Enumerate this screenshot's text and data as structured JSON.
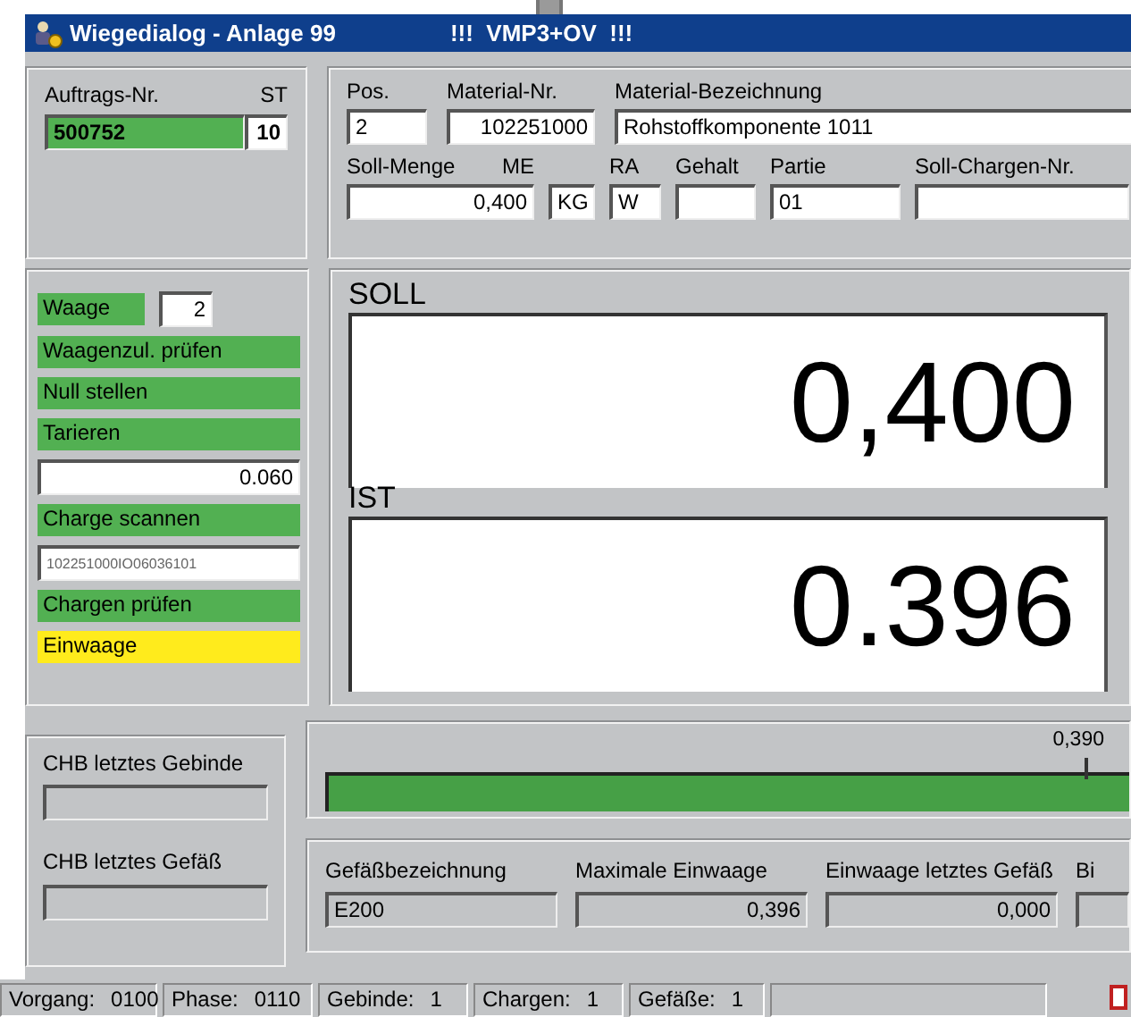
{
  "window": {
    "title": "Wiegedialog - Anlage 99",
    "banner": "!!!  VMP3+OV  !!!"
  },
  "order": {
    "label": "Auftrags-Nr.",
    "value": "500752",
    "st_label": "ST",
    "st_value": "10"
  },
  "material_rows": [
    [
      {
        "label": "Pos.",
        "value": "2"
      },
      {
        "label": "Material-Nr.",
        "value": "102251000"
      },
      {
        "label": "Material-Bezeichnung",
        "value": "Rohstoffkomponente 1011"
      }
    ],
    [
      {
        "label": "Soll-Menge",
        "label_2": "ME",
        "value": "0,400"
      },
      {
        "value": "KG"
      },
      {
        "label": "RA",
        "value": "W"
      },
      {
        "label": "Gehalt"
      },
      {
        "label": "Partie",
        "value": "01"
      },
      {
        "label": "Soll-Chargen-Nr."
      }
    ]
  ],
  "steps": [
    {
      "kind": "status",
      "label": "Waage",
      "color": "#52b052",
      "value": "2"
    },
    {
      "kind": "status",
      "label": "Waagenzul. prüfen",
      "color": "#52b052"
    },
    {
      "kind": "status",
      "label": "Null stellen",
      "color": "#52b052"
    },
    {
      "kind": "status",
      "label": "Tarieren",
      "color": "#52b052"
    },
    {
      "kind": "field",
      "value": "0.060"
    },
    {
      "kind": "status",
      "label": "Charge scannen",
      "color": "#52b052"
    },
    {
      "kind": "code",
      "value": "102251000IO06036101"
    },
    {
      "kind": "status",
      "label": "Chargen prüfen",
      "color": "#52b052"
    },
    {
      "kind": "status",
      "label": "Einwaage",
      "color": "#ffeb1c"
    }
  ],
  "weights": [
    {
      "label": "SOLL",
      "value": "0,400"
    },
    {
      "label": "IST",
      "value": "0.396"
    }
  ],
  "progress": {
    "marker": "0,390",
    "level": 1
  },
  "chb": [
    {
      "label": "CHB letztes Gebinde",
      "disabled": true
    },
    {
      "label": "CHB letztes Gefäß",
      "disabled": true
    }
  ],
  "vessel": [
    {
      "label": "Gefäßbezeichnung",
      "value": "E200",
      "disabled": true
    },
    {
      "label": "Maximale Einwaage",
      "value": "0,396",
      "disabled": true
    },
    {
      "label": "Einwaage letztes Gefäß",
      "value": "0,000",
      "disabled": true
    },
    {
      "label": "Bi",
      "disabled": true
    }
  ],
  "status_bar": [
    {
      "label": "Vorgang:",
      "value": "0100"
    },
    {
      "label": "Phase:",
      "value": "0110"
    },
    {
      "label": "Gebinde:",
      "value": "1"
    },
    {
      "label": "Chargen:",
      "value": "1"
    },
    {
      "label": "Gefäße:",
      "value": "1"
    }
  ]
}
